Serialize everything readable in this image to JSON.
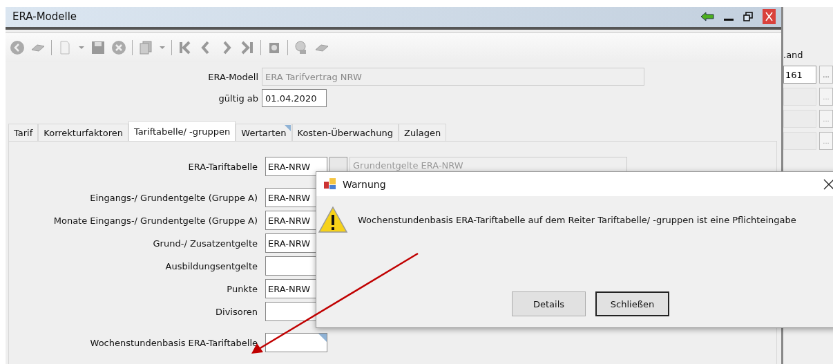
{
  "window": {
    "title": "ERA-Modelle"
  },
  "header_fields": [
    {
      "label": "ERA-Modell",
      "value": "ERA Tarifvertrag NRW",
      "disabled": true
    },
    {
      "label": "gültig ab",
      "value": "01.04.2020",
      "disabled": false
    }
  ],
  "tabs": [
    {
      "label": "Tarif",
      "selected": false,
      "marked": false
    },
    {
      "label": "Korrekturfaktoren",
      "selected": false,
      "marked": false
    },
    {
      "label": "Tariftabelle/ -gruppen",
      "selected": true,
      "marked": false
    },
    {
      "label": "Wertarten",
      "selected": false,
      "marked": true
    },
    {
      "label": "Kosten-Überwachung",
      "selected": false,
      "marked": false
    },
    {
      "label": "Zulagen",
      "selected": false,
      "marked": false
    }
  ],
  "field_groups": [
    [
      {
        "label": "ERA-Tariftabelle",
        "value": "ERA-NRW",
        "marked": false,
        "description": "Grundentgelte ERA-NRW"
      }
    ],
    [
      {
        "label": "Eingangs-/ Grundentgelte (Gruppe A)",
        "value": "ERA-NRW"
      },
      {
        "label": "Monate Eingangs-/ Grundentgelte (Gruppe A)",
        "value": "ERA-NRW"
      },
      {
        "label": "Grund-/ Zusatzentgelte",
        "value": "ERA-NRW"
      },
      {
        "label": "Ausbildungsentgelte"
      },
      {
        "label": "Punkte",
        "value": "ERA-NRW"
      },
      {
        "label": "Divisoren"
      }
    ],
    [
      {
        "label": "Wochenstundenbasis ERA-Tariftabelle",
        "marked": true
      }
    ]
  ],
  "side_panel": {
    "label": ".and",
    "rows": [
      {
        "value": "161",
        "button": "...",
        "disabled": false
      },
      {
        "button": "...",
        "disabled": true
      },
      {
        "button": "...",
        "disabled": true
      },
      {
        "button": "...",
        "disabled": true
      }
    ]
  },
  "dialog": {
    "title": "Warnung",
    "message": "Wochenstundenbasis ERA-Tariftabelle auf dem Reiter Tariftabelle/ -gruppen ist eine Pflichteingabe",
    "buttons": [
      {
        "label": "Details",
        "default": false
      },
      {
        "label": "Schließen",
        "default": true
      }
    ]
  }
}
